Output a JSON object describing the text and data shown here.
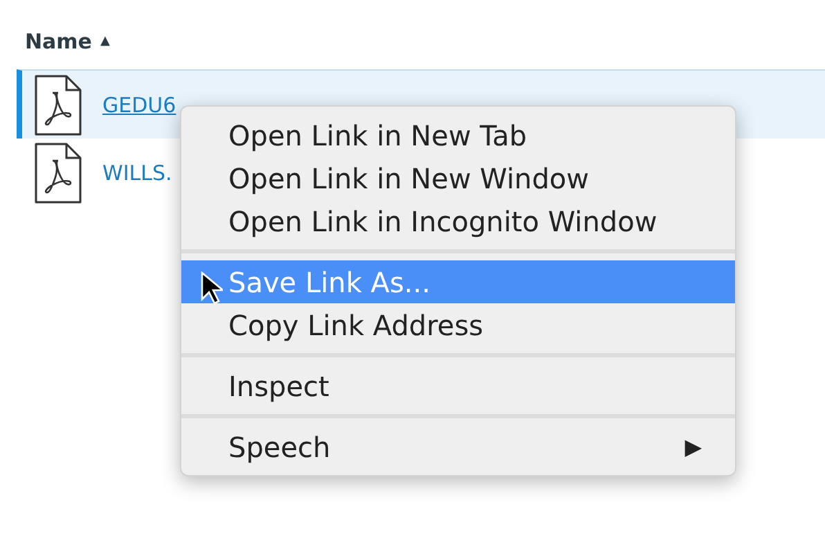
{
  "table": {
    "columns": [
      {
        "label": "Name",
        "sort_indicator": "▲"
      }
    ],
    "rows": [
      {
        "name": "GEDU6",
        "selected": true
      },
      {
        "name": "WILLS.",
        "selected": false
      }
    ]
  },
  "context_menu": {
    "groups": [
      [
        {
          "label": "Open Link in New Tab",
          "selected": false
        },
        {
          "label": "Open Link in New Window",
          "selected": false
        },
        {
          "label": "Open Link in Incognito Window",
          "selected": false
        }
      ],
      [
        {
          "label": "Save Link As...",
          "selected": true
        },
        {
          "label": "Copy Link Address",
          "selected": false
        }
      ],
      [
        {
          "label": "Inspect",
          "selected": false
        }
      ],
      [
        {
          "label": "Speech",
          "selected": false,
          "submenu_arrow": "▶"
        }
      ]
    ]
  }
}
